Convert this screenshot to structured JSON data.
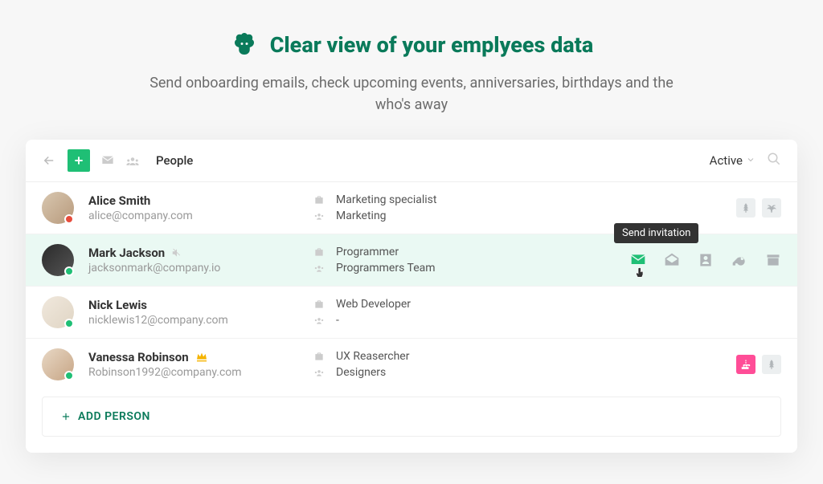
{
  "hero": {
    "title": "Clear view of your emplyees data",
    "subtitle": "Send onboarding emails, check upcoming events, anniversaries, birthdays and the who's away"
  },
  "toolbar": {
    "title": "People",
    "filter": "Active"
  },
  "people": [
    {
      "name": "Alice Smith",
      "email": "alice@company.com",
      "role": "Marketing specialist",
      "team": "Marketing",
      "status": "red",
      "avatar": "av1"
    },
    {
      "name": "Mark Jackson",
      "email": "jacksonmark@company.io",
      "role": "Programmer",
      "team": "Programmers Team",
      "status": "green",
      "avatar": "av2",
      "muted": true,
      "highlighted": true,
      "tooltip": "Send invitation"
    },
    {
      "name": "Nick Lewis",
      "email": "nicklewis12@company.com",
      "role": "Web Developer",
      "team": "-",
      "status": "green",
      "avatar": "av3"
    },
    {
      "name": "Vanessa Robinson",
      "email": "Robinson1992@company.com",
      "role": "UX Reasercher",
      "team": "Designers",
      "status": "green",
      "avatar": "av4",
      "crown": true
    }
  ],
  "add_person_label": "ADD PERSON"
}
